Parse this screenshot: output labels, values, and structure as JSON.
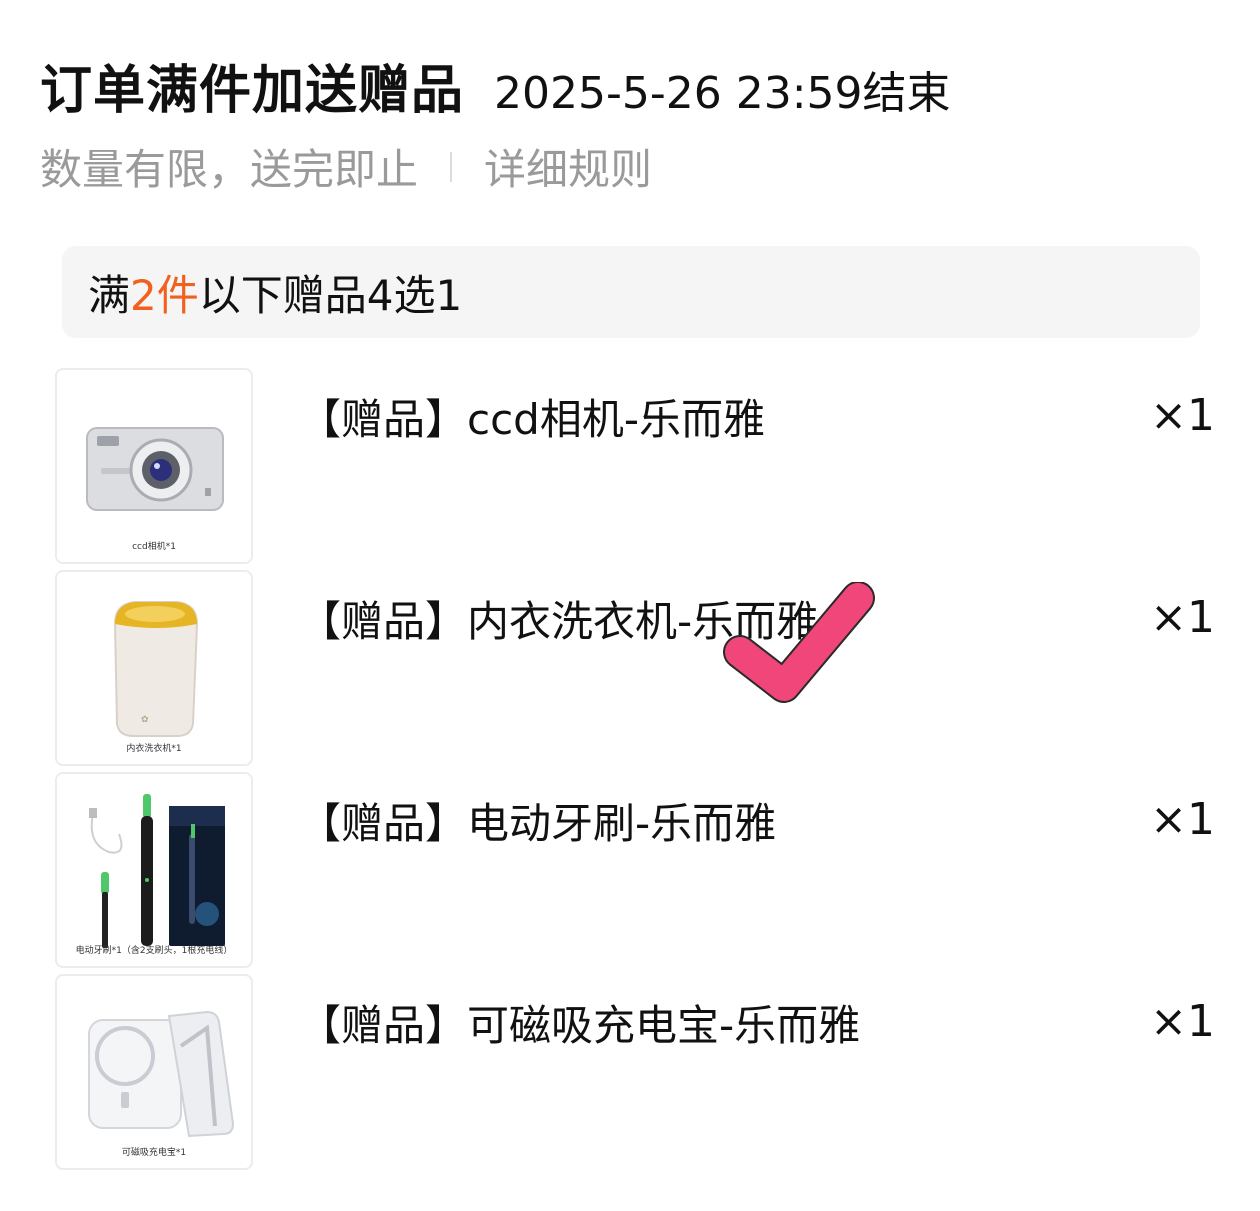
{
  "header": {
    "title": "订单满件加送赠品",
    "deadline": "2025-5-26 23:59结束",
    "limit_text": "数量有限，送完即止",
    "rules_link": "详细规则"
  },
  "tier": {
    "prefix": "满",
    "highlight": "2件",
    "suffix": "以下赠品4选1",
    "highlight_color": "#f2601e"
  },
  "gifts": [
    {
      "name": "【赠品】ccd相机-乐而雅",
      "qty": "×1",
      "thumb_caption": "ccd相机*1",
      "thumb_icon": "camera-image",
      "selected": false
    },
    {
      "name": "【赠品】内衣洗衣机-乐而雅",
      "qty": "×1",
      "thumb_caption": "内衣洗衣机*1",
      "thumb_icon": "mini-washer-image",
      "selected": true
    },
    {
      "name": "【赠品】电动牙刷-乐而雅",
      "qty": "×1",
      "thumb_caption": "电动牙刷*1（含2支刷头，1根充电线）",
      "thumb_icon": "toothbrush-image",
      "selected": false
    },
    {
      "name": "【赠品】可磁吸充电宝-乐而雅",
      "qty": "×1",
      "thumb_caption": "可磁吸充电宝*1",
      "thumb_icon": "power-bank-image",
      "selected": false
    }
  ],
  "selection_mark": {
    "icon": "pink-checkmark-icon",
    "color": "#f0467a"
  }
}
